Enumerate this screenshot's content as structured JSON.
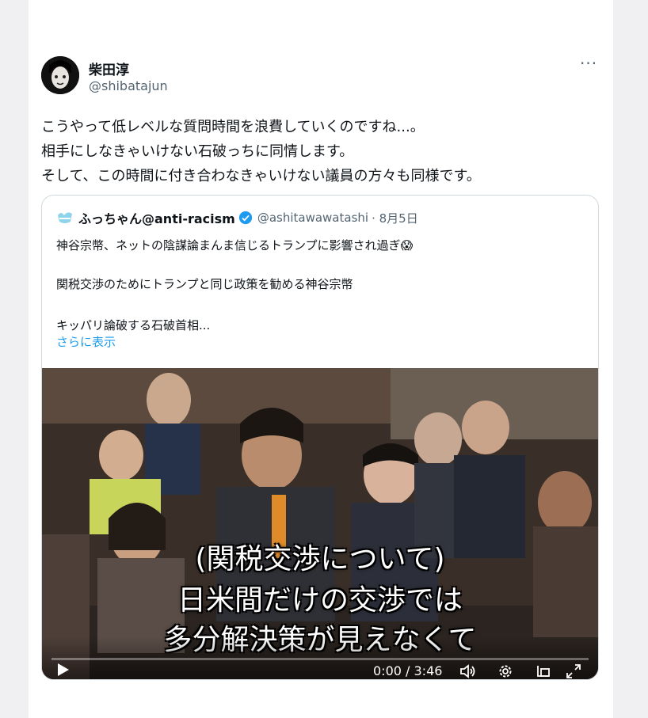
{
  "post": {
    "author_name": "柴田淳",
    "author_handle": "@shibatajun",
    "more_label": "···",
    "lines": [
      "こうやって低レベルな質問時間を浪費していくのですね...。",
      "相手にしなきゃいけない石破っちに同情します。",
      "そして、この時間に付き合わなきゃいけない議員の方々も同様です。"
    ]
  },
  "quote": {
    "author_name": "ふっちゃん@anti-racism",
    "author_handle": "@ashitawawatashi",
    "date": "· 8月5日",
    "line1": "神谷宗幣、ネットの陰謀論まんま信じるトランプに影響され過ぎ😱",
    "line2": "関税交渉のためにトランプと同じ政策を勧める神谷宗幣",
    "line3": "キッパリ論破する石破首相...",
    "show_more": "さらに表示"
  },
  "video": {
    "subtitles": [
      "(関税交渉について)",
      "日米間だけの交渉では",
      "多分解決策が見えなくて"
    ],
    "time": "0:00 / 3:46",
    "progress": 0
  },
  "icons": {
    "more": "more-horizontal-icon",
    "verified": "verified-badge-icon",
    "play": "play-icon",
    "volume": "volume-icon",
    "settings": "gear-icon",
    "airplay": "cast-icon",
    "fullscreen": "fullscreen-icon"
  },
  "colors": {
    "link": "#1d9bf0",
    "muted": "#536471",
    "verified": "#1d9bf0"
  }
}
